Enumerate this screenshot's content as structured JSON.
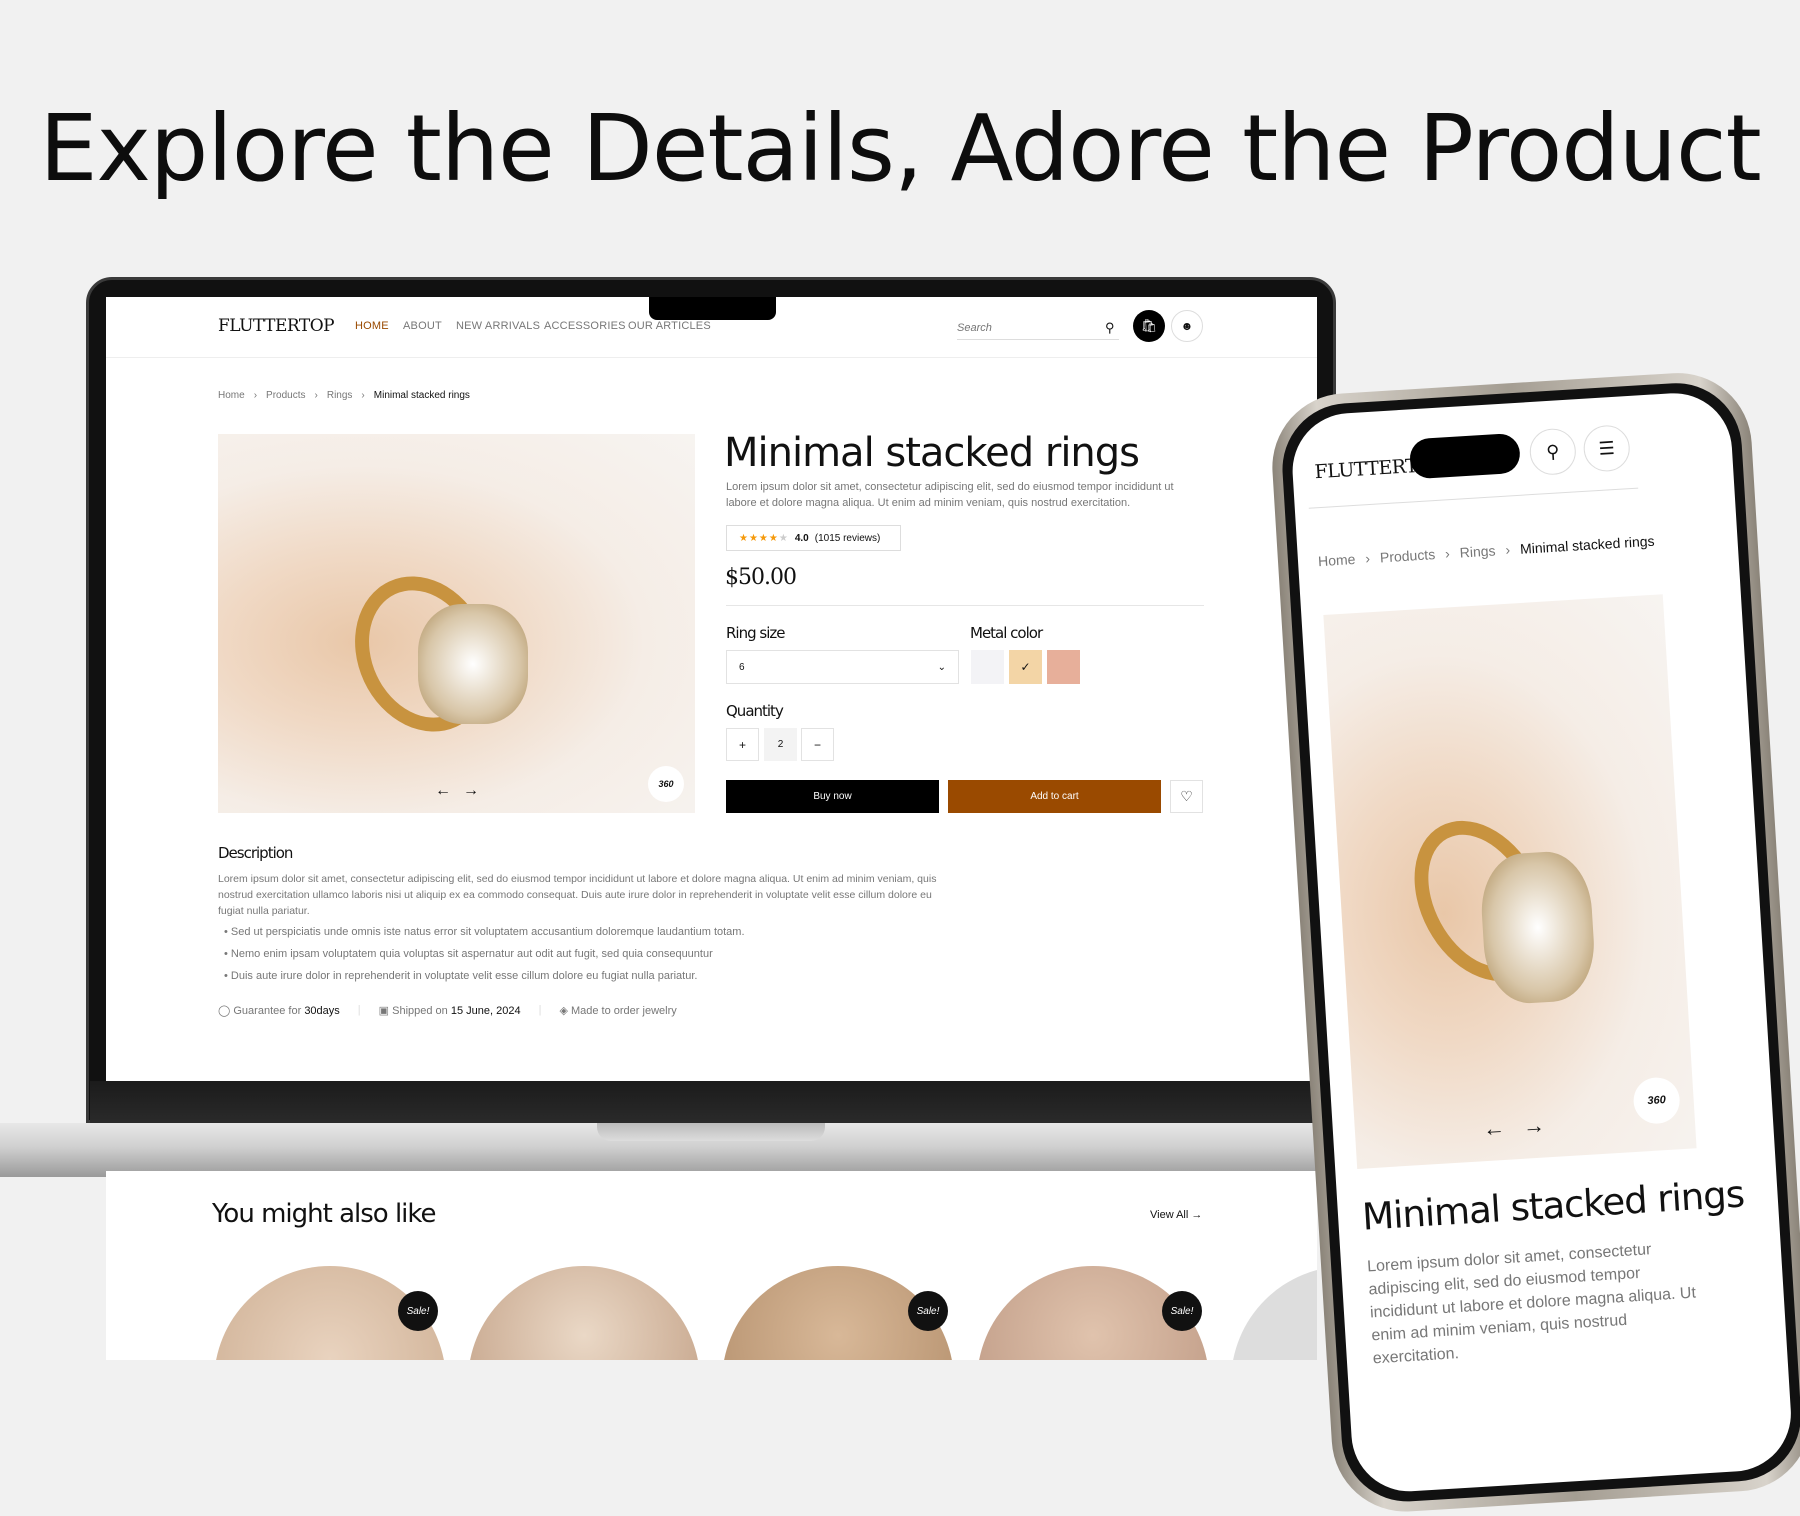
{
  "headline": "Explore the Details, Adore the Product",
  "site": {
    "logo": "FLUTTERTOP",
    "nav": [
      {
        "label": "HOME",
        "active": true
      },
      {
        "label": "ABOUT"
      },
      {
        "label": "NEW ARRIVALS"
      },
      {
        "label": "ACCESSORIES"
      },
      {
        "label": "OUR ARTICLES"
      }
    ],
    "search_placeholder": "Search",
    "icons": {
      "search": "search-icon",
      "cart": "shopping-bag-icon",
      "user": "user-icon",
      "menu": "hamburger-menu-icon"
    }
  },
  "breadcrumb": [
    "Home",
    "Products",
    "Rings",
    "Minimal stacked rings"
  ],
  "product": {
    "title": "Minimal stacked rings",
    "summary": "Lorem ipsum dolor sit amet, consectetur adipiscing elit, sed do eiusmod tempor incididunt ut labore et dolore magna aliqua. Ut enim ad minim veniam, quis nostrud exercitation.",
    "rating": 4.0,
    "rating_text": "4.0",
    "reviews": "(1015 reviews)",
    "price": "$50.00",
    "ring_size_label": "Ring size",
    "ring_size_value": "6",
    "metal_color_label": "Metal color",
    "metal_colors": [
      "#f3f3f6",
      "#f3d5a6",
      "#e7af9a"
    ],
    "selected_color": 1,
    "quantity_label": "Quantity",
    "quantity": "2",
    "buy_now": "Buy now",
    "add_to_cart": "Add to cart",
    "badge_360": "360",
    "accent_color": "#9a4a00"
  },
  "description": {
    "heading": "Description",
    "text": "Lorem ipsum dolor sit amet, consectetur adipiscing elit, sed do eiusmod tempor incididunt ut labore et dolore magna aliqua. Ut enim ad minim veniam, quis nostrud exercitation ullamco laboris nisi ut aliquip ex ea commodo consequat. Duis aute irure dolor in reprehenderit in voluptate velit esse cillum dolore eu fugiat nulla pariatur.",
    "bullets": [
      "Sed ut perspiciatis unde omnis iste natus error sit voluptatem accusantium doloremque laudantium totam.",
      "Nemo enim ipsam voluptatem quia voluptas sit aspernatur aut odit aut fugit, sed quia consequuntur",
      "Duis aute irure dolor in reprehenderit in voluptate velit esse cillum dolore eu fugiat nulla pariatur."
    ],
    "features": [
      {
        "prefix": "Guarantee for ",
        "bold": "30days"
      },
      {
        "prefix": "Shipped on ",
        "bold": "15 June, 2024"
      },
      {
        "prefix": "Made to order jewelry",
        "bold": ""
      }
    ]
  },
  "related": {
    "heading": "You might also like",
    "view_all": "View All",
    "sale_label": "Sale!"
  },
  "phone": {
    "summary": "Lorem ipsum dolor sit amet, consectetur adipiscing elit, sed do eiusmod tempor incididunt ut labore et dolore magna aliqua. Ut enim ad minim veniam, quis nostrud exercitation."
  }
}
